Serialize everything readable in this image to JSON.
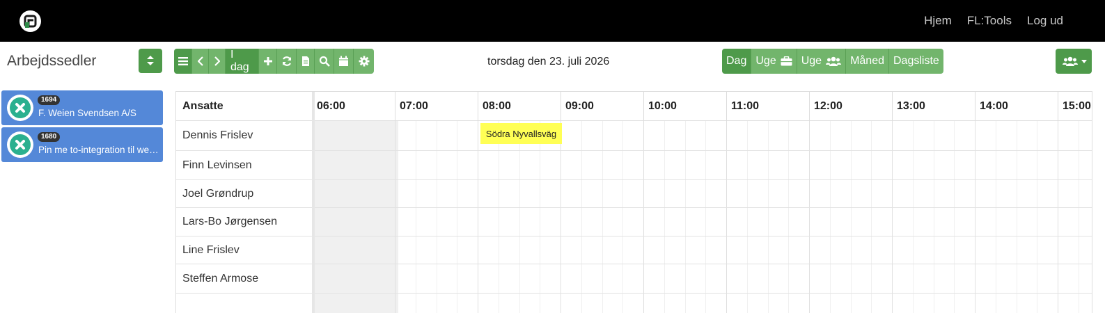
{
  "nav": {
    "links": [
      "Hjem",
      "FL:Tools",
      "Log ud"
    ]
  },
  "left_panel": {
    "title": "Arbejdssedler",
    "cards": [
      {
        "badge": "1694",
        "title": "F. Weien Svendsen A/S"
      },
      {
        "badge": "1680",
        "title": "Pin me to-integration til webshop"
      }
    ]
  },
  "toolbar": {
    "today_label": "I dag",
    "icons": [
      "menu-icon",
      "chevron-left-icon",
      "chevron-right-icon",
      "plus-icon",
      "refresh-icon",
      "document-icon",
      "search-icon",
      "calendar-icon",
      "gear-icon"
    ]
  },
  "date_label": "torsdag den 23. juli 2026",
  "views": {
    "day": "Dag",
    "week_jobs": "Uge",
    "week_users": "Uge",
    "month": "Måned",
    "daylist": "Dagsliste"
  },
  "grid": {
    "employees_header": "Ansatte",
    "hours": [
      "06:00",
      "07:00",
      "08:00",
      "09:00",
      "10:00",
      "11:00",
      "12:00",
      "13:00",
      "14:00",
      "15:00"
    ],
    "employees": [
      "Dennis Frislev",
      "Finn Levinsen",
      "Joel Grøndrup",
      "Lars-Bo Jørgensen",
      "Line Frislev",
      "Steffen Armose"
    ],
    "events": [
      {
        "employee": "Dennis Frislev",
        "start": "08:00",
        "end": "09:00",
        "title": "Södra Nyvallsväg"
      }
    ]
  },
  "colors": {
    "primary_green": "#4e9a4a",
    "light_green": "#72b56c",
    "card_blue": "#5488d8",
    "event_yellow": "#ffff55"
  }
}
